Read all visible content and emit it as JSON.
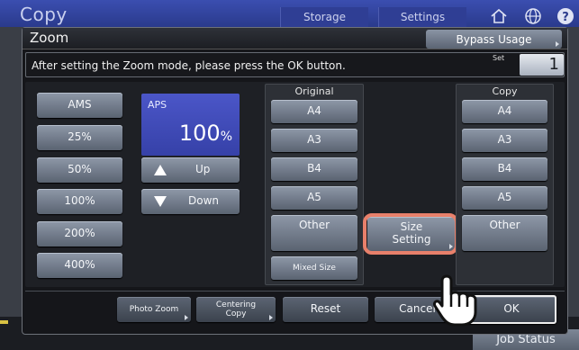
{
  "app": {
    "title": "Copy",
    "tabs": [
      "Storage",
      "Settings"
    ],
    "job_status": "Job Status"
  },
  "dialog": {
    "title": "Zoom",
    "bypass_label": "Bypass Usage",
    "message": "After setting the Zoom mode, please press the OK button.",
    "set_label": "Set",
    "set_value": "1"
  },
  "zoom": {
    "presets": [
      "AMS",
      "25%",
      "50%",
      "100%",
      "200%",
      "400%"
    ],
    "aps_label": "APS",
    "aps_value": "100",
    "aps_unit": "%",
    "up_label": "Up",
    "down_label": "Down"
  },
  "original": {
    "title": "Original",
    "sizes": [
      "A4",
      "A3",
      "B4",
      "A5",
      "Other"
    ],
    "mixed_label": "Mixed Size"
  },
  "size_setting": {
    "line1": "Size",
    "line2": "Setting"
  },
  "copy": {
    "title": "Copy",
    "sizes": [
      "A4",
      "A3",
      "B4",
      "A5",
      "Other"
    ]
  },
  "footer": {
    "photo_zoom": "Photo Zoom",
    "centering_line1": "Centering",
    "centering_line2": "Copy",
    "reset": "Reset",
    "cancel": "Cancel",
    "ok": "OK"
  },
  "colors": {
    "highlight": "#e8806b",
    "aps_accent": "#4b56c8"
  }
}
